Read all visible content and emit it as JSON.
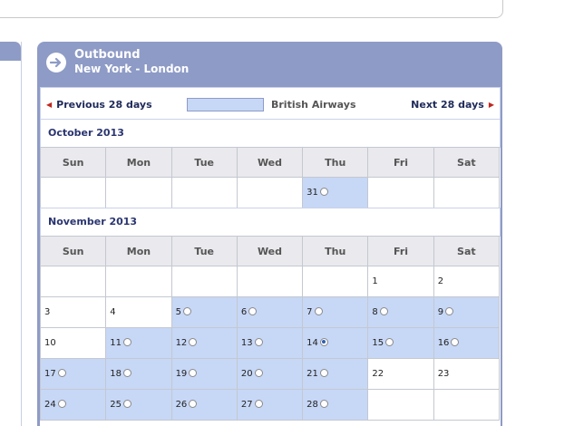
{
  "outbound": {
    "title": "Outbound",
    "route": "New York - London"
  },
  "nav": {
    "prev_label": "Previous 28 days",
    "next_label": "Next 28 days",
    "legend_label": "British Airways"
  },
  "weekdays": [
    "Sun",
    "Mon",
    "Tue",
    "Wed",
    "Thu",
    "Fri",
    "Sat"
  ],
  "months": [
    {
      "label": "October 2013",
      "weeks": [
        [
          {
            "day": "",
            "available": false
          },
          {
            "day": "",
            "available": false
          },
          {
            "day": "",
            "available": false
          },
          {
            "day": "",
            "available": false
          },
          {
            "day": "31",
            "available": true,
            "selected": false
          },
          {
            "day": "",
            "available": false
          },
          {
            "day": "",
            "available": false
          }
        ]
      ]
    },
    {
      "label": "November 2013",
      "weeks": [
        [
          {
            "day": "",
            "available": false
          },
          {
            "day": "",
            "available": false
          },
          {
            "day": "",
            "available": false
          },
          {
            "day": "",
            "available": false
          },
          {
            "day": "",
            "available": false
          },
          {
            "day": "1",
            "available": false
          },
          {
            "day": "2",
            "available": false
          }
        ],
        [
          {
            "day": "3",
            "available": false
          },
          {
            "day": "4",
            "available": false
          },
          {
            "day": "5",
            "available": true,
            "selected": false
          },
          {
            "day": "6",
            "available": true,
            "selected": false
          },
          {
            "day": "7",
            "available": true,
            "selected": false
          },
          {
            "day": "8",
            "available": true,
            "selected": false
          },
          {
            "day": "9",
            "available": true,
            "selected": false
          }
        ],
        [
          {
            "day": "10",
            "available": false
          },
          {
            "day": "11",
            "available": true,
            "selected": false
          },
          {
            "day": "12",
            "available": true,
            "selected": false
          },
          {
            "day": "13",
            "available": true,
            "selected": false
          },
          {
            "day": "14",
            "available": true,
            "selected": true
          },
          {
            "day": "15",
            "available": true,
            "selected": false
          },
          {
            "day": "16",
            "available": true,
            "selected": false
          }
        ],
        [
          {
            "day": "17",
            "available": true,
            "selected": false
          },
          {
            "day": "18",
            "available": true,
            "selected": false
          },
          {
            "day": "19",
            "available": true,
            "selected": false
          },
          {
            "day": "20",
            "available": true,
            "selected": false
          },
          {
            "day": "21",
            "available": true,
            "selected": false
          },
          {
            "day": "22",
            "available": false
          },
          {
            "day": "23",
            "available": false
          }
        ],
        [
          {
            "day": "24",
            "available": true,
            "selected": false
          },
          {
            "day": "25",
            "available": true,
            "selected": false
          },
          {
            "day": "26",
            "available": true,
            "selected": false
          },
          {
            "day": "27",
            "available": true,
            "selected": false
          },
          {
            "day": "28",
            "available": true,
            "selected": false
          },
          {
            "day": "",
            "available": false
          },
          {
            "day": "",
            "available": false
          }
        ]
      ]
    }
  ],
  "colors": {
    "header_bg": "#8e9bc6",
    "available_bg": "#c7d7f6",
    "weekday_bg": "#e9e9ee",
    "nav_arrow": "#c0271f",
    "link_text": "#1f2a5a"
  },
  "icons": {
    "outbound": "arrow-right-circle-icon",
    "prev": "triangle-left-icon",
    "next": "triangle-right-icon"
  }
}
